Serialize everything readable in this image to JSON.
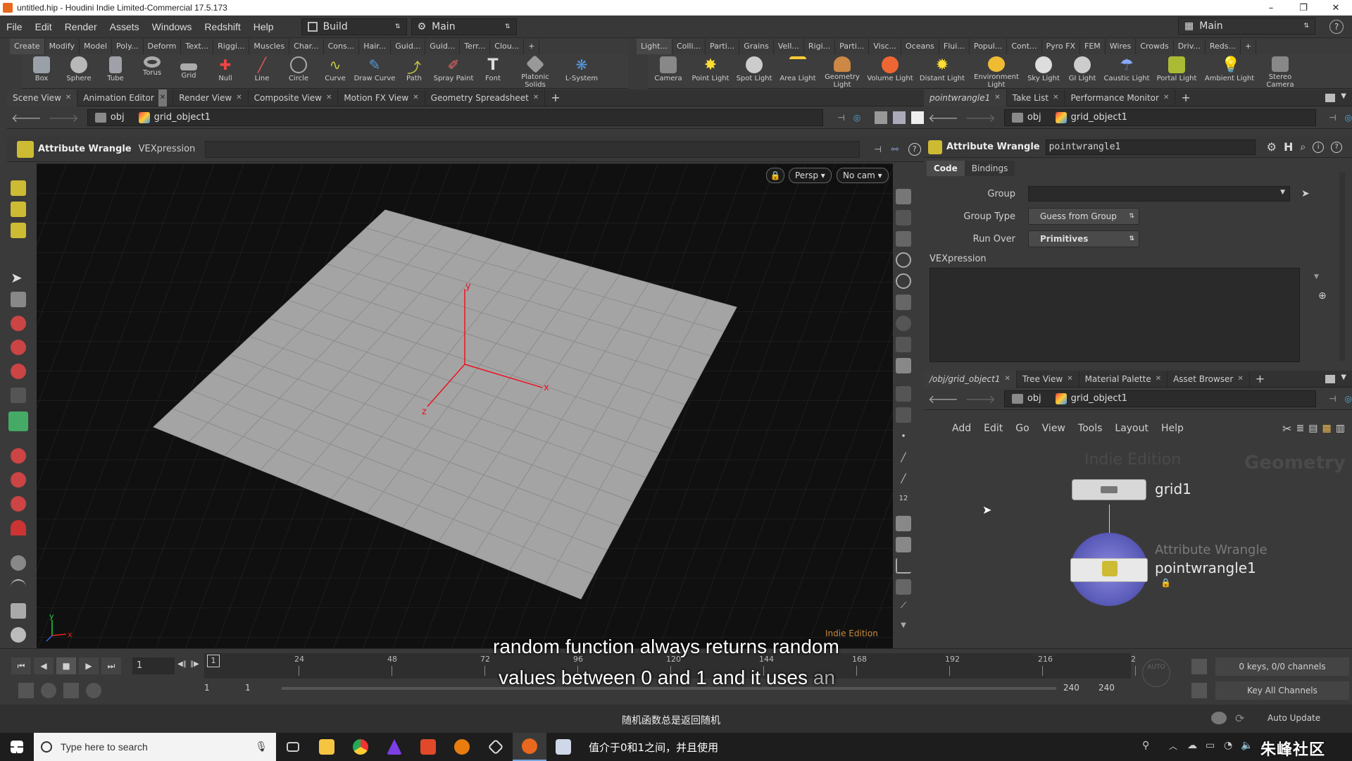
{
  "window": {
    "title": "untitled.hip - Houdini Indie Limited-Commercial 17.5.173",
    "controls": [
      "–",
      "❐",
      "✕"
    ]
  },
  "menubar": {
    "items": [
      "File",
      "Edit",
      "Render",
      "Assets",
      "Windows",
      "Redshift",
      "Help"
    ],
    "desktop": "Build",
    "context": "Main",
    "right_context": "Main"
  },
  "shelf_left": {
    "tabs": [
      "Create",
      "Modify",
      "Model",
      "Poly...",
      "Deform",
      "Text...",
      "Riggi...",
      "Muscles",
      "Char...",
      "Cons...",
      "Hair...",
      "Guid...",
      "Guid...",
      "Terr...",
      "Clou..."
    ],
    "tools": [
      "Box",
      "Sphere",
      "Tube",
      "Torus",
      "Grid",
      "Null",
      "Line",
      "Circle",
      "Curve",
      "Draw Curve",
      "Path",
      "Spray Paint",
      "Font",
      "Platonic Solids",
      "L-System"
    ]
  },
  "shelf_right": {
    "tabs": [
      "Light...",
      "Colli...",
      "Parti...",
      "Grains",
      "Vell...",
      "Rigi...",
      "Parti...",
      "Visc...",
      "Oceans",
      "Flui...",
      "Popul...",
      "Cont...",
      "Pyro FX",
      "FEM",
      "Wires",
      "Crowds",
      "Driv...",
      "Reds..."
    ],
    "tools": [
      "Camera",
      "Point Light",
      "Spot Light",
      "Area Light",
      "Geometry Light",
      "Volume Light",
      "Distant Light",
      "Environment Light",
      "Sky Light",
      "GI Light",
      "Caustic Light",
      "Portal Light",
      "Ambient Light",
      "Stereo Camera"
    ]
  },
  "left_panel": {
    "tabs": [
      "Scene View",
      "Animation Editor",
      "Render View",
      "Composite View",
      "Motion FX View",
      "Geometry Spreadsheet"
    ],
    "path": {
      "root": "obj",
      "node": "grid_object1"
    },
    "op_label": "Attribute Wrangle",
    "op_field": "VEXpression",
    "viewport": {
      "persp": "Persp ▾",
      "cam": "No cam ▾",
      "watermark": "Indie Edition",
      "axes": [
        "y",
        "x",
        "z"
      ]
    }
  },
  "params": {
    "tabs": [
      "pointwrangle1",
      "Take List",
      "Performance Monitor"
    ],
    "path": {
      "root": "obj",
      "node": "grid_object1"
    },
    "node_type": "Attribute Wrangle",
    "node_name": "pointwrangle1",
    "subtabs": [
      "Code",
      "Bindings"
    ],
    "group_label": "Group",
    "group_type_label": "Group Type",
    "group_type_value": "Guess from Group",
    "run_over_label": "Run Over",
    "run_over_value": "Primitives",
    "vex_label": "VEXpression"
  },
  "network": {
    "tabs": [
      "/obj/grid_object1",
      "Tree View",
      "Material Palette",
      "Asset Browser"
    ],
    "path": {
      "root": "obj",
      "node": "grid_object1"
    },
    "menu": [
      "Add",
      "Edit",
      "Go",
      "View",
      "Tools",
      "Layout",
      "Help"
    ],
    "watermark": "Indie Edition",
    "context_label": "Geometry",
    "nodes": [
      {
        "name": "grid1",
        "type": ""
      },
      {
        "name": "pointwrangle1",
        "type": "Attribute Wrangle"
      }
    ]
  },
  "timeline": {
    "frame": "1",
    "start_frame_marker": "1",
    "ticks": [
      "24",
      "48",
      "72",
      "96",
      "120",
      "144",
      "168",
      "192",
      "216",
      "2"
    ],
    "range_start": "1",
    "range_start2": "1",
    "range_end": "240",
    "range_end2": "240",
    "keys_info": "0 keys, 0/0 channels",
    "key_all": "Key All Channels",
    "auto_update": "Auto Update",
    "auto_label": "AUTO"
  },
  "subtitles": {
    "line1": "random function always returns random",
    "line2_main": "values between 0 and 1 and it uses",
    "line2_faded": "an",
    "cn_line1": "随机函数总是返回随机",
    "cn_line2": "值介于0和1之间，并且使用"
  },
  "taskbar": {
    "search_placeholder": "Type here to search",
    "brand": "朱峰社区"
  }
}
